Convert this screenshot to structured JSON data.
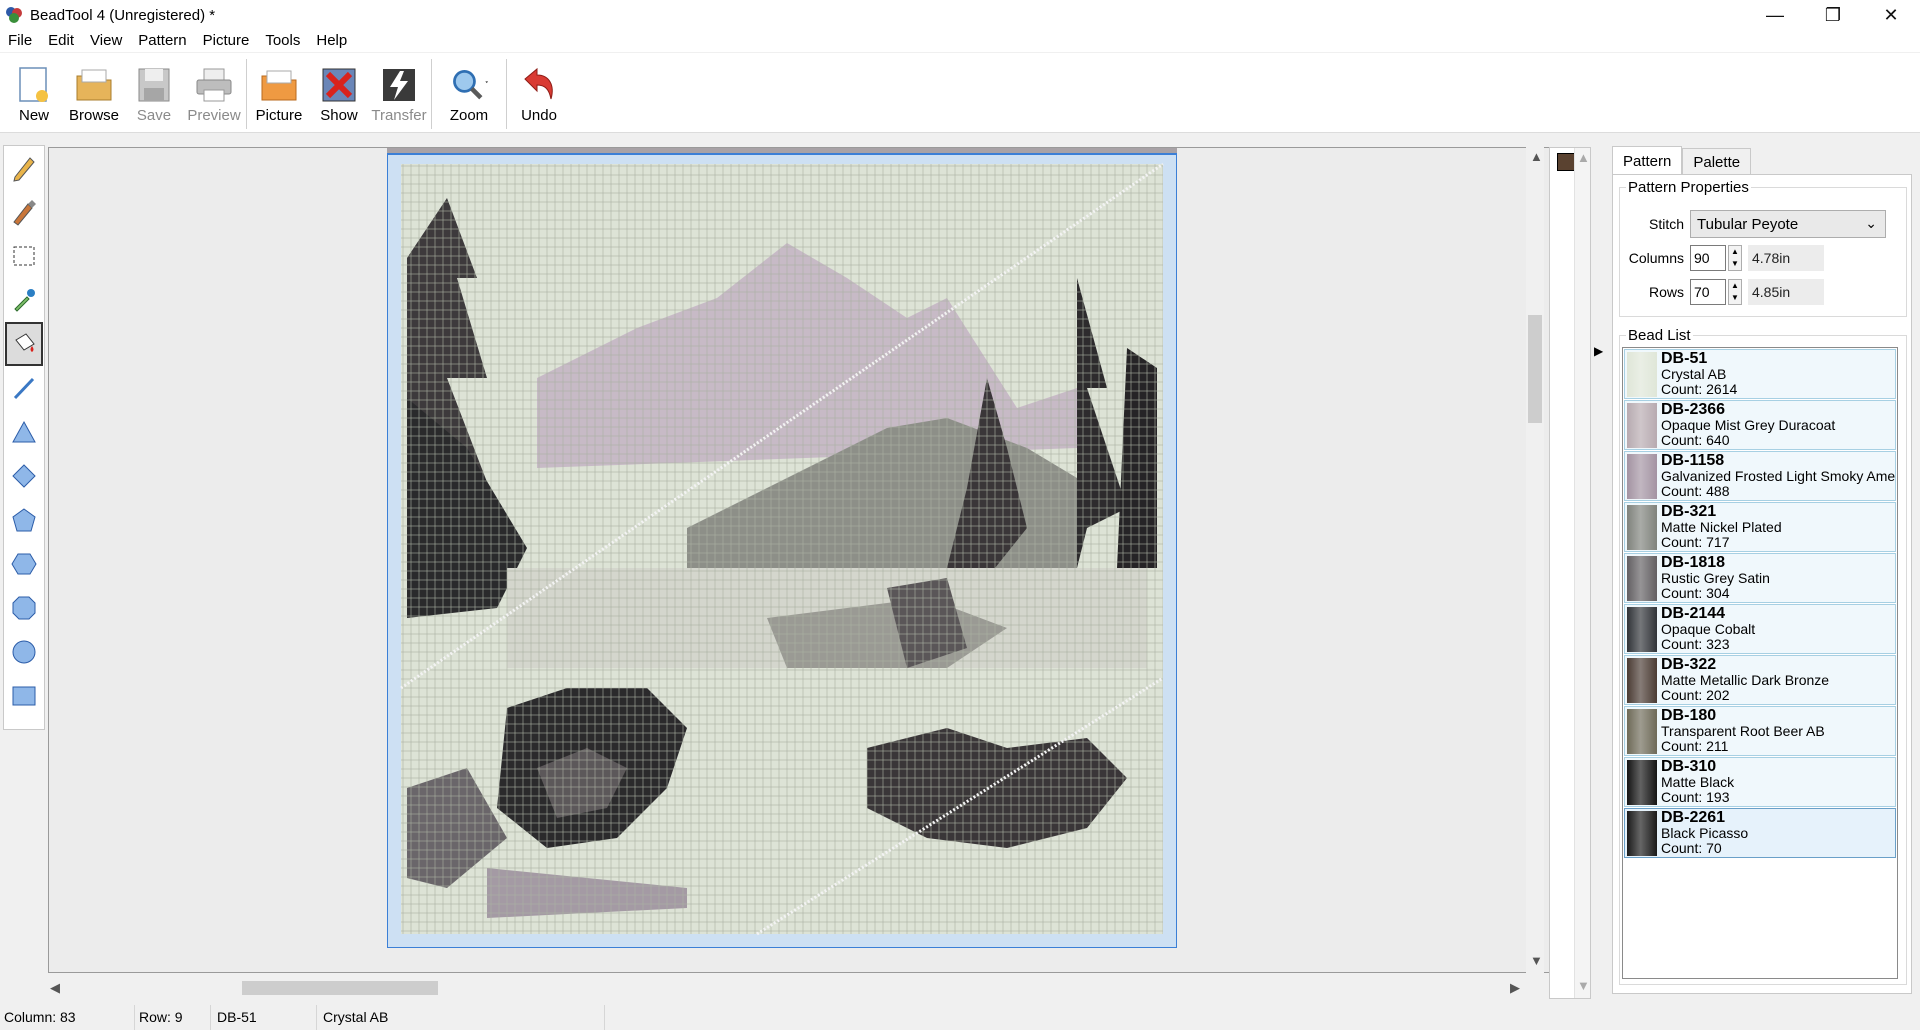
{
  "window": {
    "title": "BeadTool 4 (Unregistered) *"
  },
  "menu": [
    "File",
    "Edit",
    "View",
    "Pattern",
    "Picture",
    "Tools",
    "Help"
  ],
  "toolbar": {
    "new": "New",
    "browse": "Browse",
    "save": "Save",
    "preview": "Preview",
    "picture": "Picture",
    "show": "Show",
    "transfer": "Transfer",
    "zoom": "Zoom",
    "undo": "Undo"
  },
  "tabs": {
    "pattern": "Pattern",
    "palette": "Palette"
  },
  "pattern_properties": {
    "title": "Pattern Properties",
    "stitch_label": "Stitch",
    "stitch_value": "Tubular Peyote",
    "columns_label": "Columns",
    "columns_value": "90",
    "columns_size": "4.78in",
    "rows_label": "Rows",
    "rows_value": "70",
    "rows_size": "4.85in"
  },
  "bead_list": {
    "title": "Bead List",
    "items": [
      {
        "code": "DB-51",
        "name": "Crystal AB",
        "count": "Count: 2614",
        "color": "#dfe6d8"
      },
      {
        "code": "DB-2366",
        "name": "Opaque Mist Grey Duracoat",
        "count": "Count: 640",
        "color": "#b7aab0"
      },
      {
        "code": "DB-1158",
        "name": "Galvanized Frosted Light Smoky Amethyst",
        "count": "Count: 488",
        "color": "#a393a2"
      },
      {
        "code": "DB-321",
        "name": "Matte Nickel Plated",
        "count": "Count: 717",
        "color": "#7f827c"
      },
      {
        "code": "DB-1818",
        "name": "Rustic Grey Satin",
        "count": "Count: 304",
        "color": "#625f62"
      },
      {
        "code": "DB-2144",
        "name": "Opaque Cobalt",
        "count": "Count: 323",
        "color": "#303338"
      },
      {
        "code": "DB-322",
        "name": "Matte Metallic Dark Bronze",
        "count": "Count: 202",
        "color": "#4a3b33"
      },
      {
        "code": "DB-180",
        "name": "Transparent Root Beer AB",
        "count": "Count: 211",
        "color": "#6e6a58"
      },
      {
        "code": "DB-310",
        "name": "Matte Black",
        "count": "Count: 193",
        "color": "#141414"
      },
      {
        "code": "DB-2261",
        "name": "Black Picasso",
        "count": "Count: 70",
        "color": "#1a1a1a"
      }
    ]
  },
  "status": {
    "column": "Column: 83",
    "row": "Row: 9",
    "code": "DB-51",
    "name": "Crystal AB"
  },
  "colors": {
    "grid_border": "#3b7fd6",
    "selection": "#cde6f7"
  }
}
